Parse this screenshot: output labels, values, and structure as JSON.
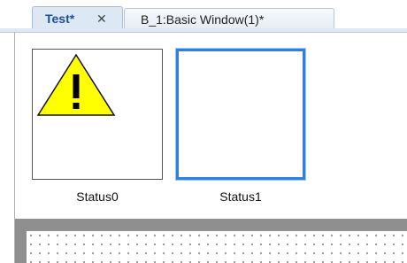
{
  "tabs": {
    "active": {
      "label": "Test*",
      "close_glyph": "✕"
    },
    "inactive": {
      "label": "B_1:Basic Window(1)*"
    }
  },
  "items": [
    {
      "caption": "Status0",
      "icon": "warning-triangle-icon",
      "icon_fill": "#ffff00",
      "selected": false
    },
    {
      "caption": "Status1",
      "icon": null,
      "selected": true,
      "selection_color": "#2f7fe0"
    }
  ]
}
